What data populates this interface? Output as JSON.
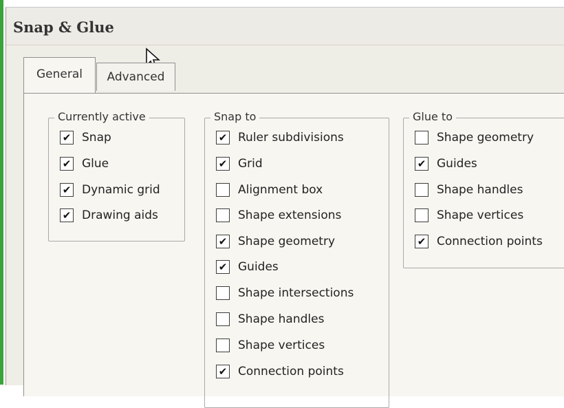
{
  "window": {
    "title": "Snap & Glue"
  },
  "tabs": [
    {
      "label": "General",
      "active": true
    },
    {
      "label": "Advanced",
      "active": false
    }
  ],
  "groups": {
    "currently_active": {
      "label": "Currently active",
      "items": [
        {
          "label": "Snap",
          "checked": true
        },
        {
          "label": "Glue",
          "checked": true
        },
        {
          "label": "Dynamic grid",
          "checked": true
        },
        {
          "label": "Drawing aids",
          "checked": true
        }
      ]
    },
    "snap_to": {
      "label": "Snap to",
      "items": [
        {
          "label": "Ruler subdivisions",
          "checked": true
        },
        {
          "label": "Grid",
          "checked": true
        },
        {
          "label": "Alignment box",
          "checked": false
        },
        {
          "label": "Shape extensions",
          "checked": false
        },
        {
          "label": "Shape geometry",
          "checked": true
        },
        {
          "label": "Guides",
          "checked": true
        },
        {
          "label": "Shape intersections",
          "checked": false
        },
        {
          "label": "Shape handles",
          "checked": false
        },
        {
          "label": "Shape vertices",
          "checked": false
        },
        {
          "label": "Connection points",
          "checked": true
        }
      ]
    },
    "glue_to": {
      "label": "Glue to",
      "items": [
        {
          "label": "Shape geometry",
          "checked": false
        },
        {
          "label": "Guides",
          "checked": true
        },
        {
          "label": "Shape handles",
          "checked": false
        },
        {
          "label": "Shape vertices",
          "checked": false
        },
        {
          "label": "Connection points",
          "checked": true
        }
      ]
    }
  },
  "check_glyph": "✔"
}
